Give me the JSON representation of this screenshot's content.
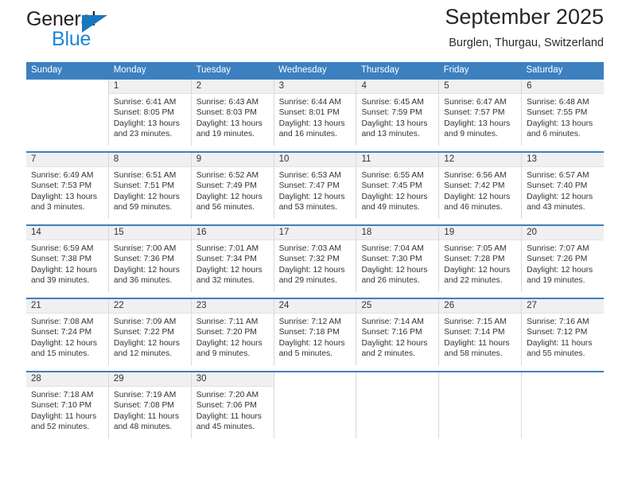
{
  "brand": {
    "name_top": "General",
    "name_bottom": "Blue",
    "triangle_color": "#1878be",
    "blue_color": "#1b87d6"
  },
  "header": {
    "title": "September 2025",
    "subtitle": "Burglen, Thurgau, Switzerland"
  },
  "theme": {
    "header_blue": "#3c80c0",
    "daynum_band": "#f0f0f0",
    "cell_border": "#d9d9d9"
  },
  "calendar": {
    "weekday_headers": [
      "Sunday",
      "Monday",
      "Tuesday",
      "Wednesday",
      "Thursday",
      "Friday",
      "Saturday"
    ],
    "labels": {
      "sunrise": "Sunrise:",
      "sunset": "Sunset:",
      "daylight": "Daylight:"
    },
    "weeks": [
      [
        {
          "day": "",
          "sunrise": "",
          "sunset": "",
          "daylight": ""
        },
        {
          "day": "1",
          "sunrise": "Sunrise: 6:41 AM",
          "sunset": "Sunset: 8:05 PM",
          "daylight": "Daylight: 13 hours and 23 minutes."
        },
        {
          "day": "2",
          "sunrise": "Sunrise: 6:43 AM",
          "sunset": "Sunset: 8:03 PM",
          "daylight": "Daylight: 13 hours and 19 minutes."
        },
        {
          "day": "3",
          "sunrise": "Sunrise: 6:44 AM",
          "sunset": "Sunset: 8:01 PM",
          "daylight": "Daylight: 13 hours and 16 minutes."
        },
        {
          "day": "4",
          "sunrise": "Sunrise: 6:45 AM",
          "sunset": "Sunset: 7:59 PM",
          "daylight": "Daylight: 13 hours and 13 minutes."
        },
        {
          "day": "5",
          "sunrise": "Sunrise: 6:47 AM",
          "sunset": "Sunset: 7:57 PM",
          "daylight": "Daylight: 13 hours and 9 minutes."
        },
        {
          "day": "6",
          "sunrise": "Sunrise: 6:48 AM",
          "sunset": "Sunset: 7:55 PM",
          "daylight": "Daylight: 13 hours and 6 minutes."
        }
      ],
      [
        {
          "day": "7",
          "sunrise": "Sunrise: 6:49 AM",
          "sunset": "Sunset: 7:53 PM",
          "daylight": "Daylight: 13 hours and 3 minutes."
        },
        {
          "day": "8",
          "sunrise": "Sunrise: 6:51 AM",
          "sunset": "Sunset: 7:51 PM",
          "daylight": "Daylight: 12 hours and 59 minutes."
        },
        {
          "day": "9",
          "sunrise": "Sunrise: 6:52 AM",
          "sunset": "Sunset: 7:49 PM",
          "daylight": "Daylight: 12 hours and 56 minutes."
        },
        {
          "day": "10",
          "sunrise": "Sunrise: 6:53 AM",
          "sunset": "Sunset: 7:47 PM",
          "daylight": "Daylight: 12 hours and 53 minutes."
        },
        {
          "day": "11",
          "sunrise": "Sunrise: 6:55 AM",
          "sunset": "Sunset: 7:45 PM",
          "daylight": "Daylight: 12 hours and 49 minutes."
        },
        {
          "day": "12",
          "sunrise": "Sunrise: 6:56 AM",
          "sunset": "Sunset: 7:42 PM",
          "daylight": "Daylight: 12 hours and 46 minutes."
        },
        {
          "day": "13",
          "sunrise": "Sunrise: 6:57 AM",
          "sunset": "Sunset: 7:40 PM",
          "daylight": "Daylight: 12 hours and 43 minutes."
        }
      ],
      [
        {
          "day": "14",
          "sunrise": "Sunrise: 6:59 AM",
          "sunset": "Sunset: 7:38 PM",
          "daylight": "Daylight: 12 hours and 39 minutes."
        },
        {
          "day": "15",
          "sunrise": "Sunrise: 7:00 AM",
          "sunset": "Sunset: 7:36 PM",
          "daylight": "Daylight: 12 hours and 36 minutes."
        },
        {
          "day": "16",
          "sunrise": "Sunrise: 7:01 AM",
          "sunset": "Sunset: 7:34 PM",
          "daylight": "Daylight: 12 hours and 32 minutes."
        },
        {
          "day": "17",
          "sunrise": "Sunrise: 7:03 AM",
          "sunset": "Sunset: 7:32 PM",
          "daylight": "Daylight: 12 hours and 29 minutes."
        },
        {
          "day": "18",
          "sunrise": "Sunrise: 7:04 AM",
          "sunset": "Sunset: 7:30 PM",
          "daylight": "Daylight: 12 hours and 26 minutes."
        },
        {
          "day": "19",
          "sunrise": "Sunrise: 7:05 AM",
          "sunset": "Sunset: 7:28 PM",
          "daylight": "Daylight: 12 hours and 22 minutes."
        },
        {
          "day": "20",
          "sunrise": "Sunrise: 7:07 AM",
          "sunset": "Sunset: 7:26 PM",
          "daylight": "Daylight: 12 hours and 19 minutes."
        }
      ],
      [
        {
          "day": "21",
          "sunrise": "Sunrise: 7:08 AM",
          "sunset": "Sunset: 7:24 PM",
          "daylight": "Daylight: 12 hours and 15 minutes."
        },
        {
          "day": "22",
          "sunrise": "Sunrise: 7:09 AM",
          "sunset": "Sunset: 7:22 PM",
          "daylight": "Daylight: 12 hours and 12 minutes."
        },
        {
          "day": "23",
          "sunrise": "Sunrise: 7:11 AM",
          "sunset": "Sunset: 7:20 PM",
          "daylight": "Daylight: 12 hours and 9 minutes."
        },
        {
          "day": "24",
          "sunrise": "Sunrise: 7:12 AM",
          "sunset": "Sunset: 7:18 PM",
          "daylight": "Daylight: 12 hours and 5 minutes."
        },
        {
          "day": "25",
          "sunrise": "Sunrise: 7:14 AM",
          "sunset": "Sunset: 7:16 PM",
          "daylight": "Daylight: 12 hours and 2 minutes."
        },
        {
          "day": "26",
          "sunrise": "Sunrise: 7:15 AM",
          "sunset": "Sunset: 7:14 PM",
          "daylight": "Daylight: 11 hours and 58 minutes."
        },
        {
          "day": "27",
          "sunrise": "Sunrise: 7:16 AM",
          "sunset": "Sunset: 7:12 PM",
          "daylight": "Daylight: 11 hours and 55 minutes."
        }
      ],
      [
        {
          "day": "28",
          "sunrise": "Sunrise: 7:18 AM",
          "sunset": "Sunset: 7:10 PM",
          "daylight": "Daylight: 11 hours and 52 minutes."
        },
        {
          "day": "29",
          "sunrise": "Sunrise: 7:19 AM",
          "sunset": "Sunset: 7:08 PM",
          "daylight": "Daylight: 11 hours and 48 minutes."
        },
        {
          "day": "30",
          "sunrise": "Sunrise: 7:20 AM",
          "sunset": "Sunset: 7:06 PM",
          "daylight": "Daylight: 11 hours and 45 minutes."
        },
        {
          "day": "",
          "sunrise": "",
          "sunset": "",
          "daylight": ""
        },
        {
          "day": "",
          "sunrise": "",
          "sunset": "",
          "daylight": ""
        },
        {
          "day": "",
          "sunrise": "",
          "sunset": "",
          "daylight": ""
        },
        {
          "day": "",
          "sunrise": "",
          "sunset": "",
          "daylight": ""
        }
      ]
    ]
  }
}
